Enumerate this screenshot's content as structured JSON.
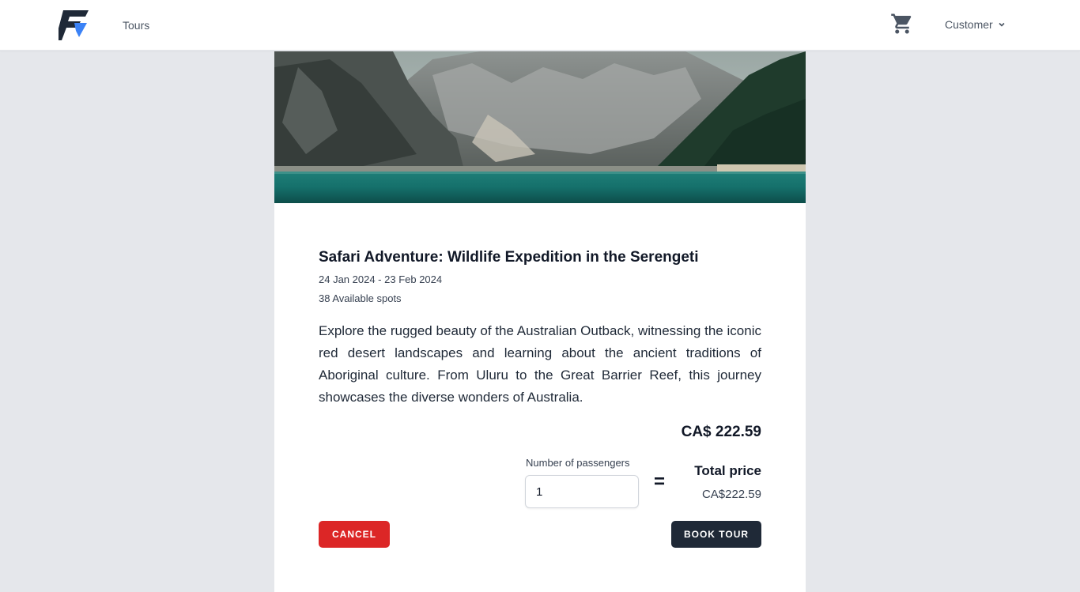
{
  "header": {
    "nav_tours": "Tours",
    "user_menu": "Customer",
    "logo_icon": "brand-logo-icon",
    "cart_icon": "shopping-cart-icon"
  },
  "tour": {
    "title": "Safari Adventure: Wildlife Expedition in the Serengeti",
    "dates": "24 Jan 2024 - 23 Feb 2024",
    "spots": "38 Available spots",
    "description": "Explore the rugged beauty of the Australian Outback, witnessing the iconic red desert landscapes and learning about the ancient traditions of Aboriginal culture. From Uluru to the Great Barrier Reef, this journey showcases the diverse wonders of Australia.",
    "price": "CA$ 222.59"
  },
  "booking": {
    "passengers_label": "Number of passengers",
    "passengers_value": "1",
    "equals": "=",
    "total_label": "Total price",
    "total_value": "CA$222.59",
    "cancel_label": "Cancel",
    "book_label": "Book tour"
  },
  "colors": {
    "cancel": "#dc2626",
    "book": "#1f2937",
    "logo_dark": "#1f2937",
    "logo_accent": "#3b82f6"
  }
}
